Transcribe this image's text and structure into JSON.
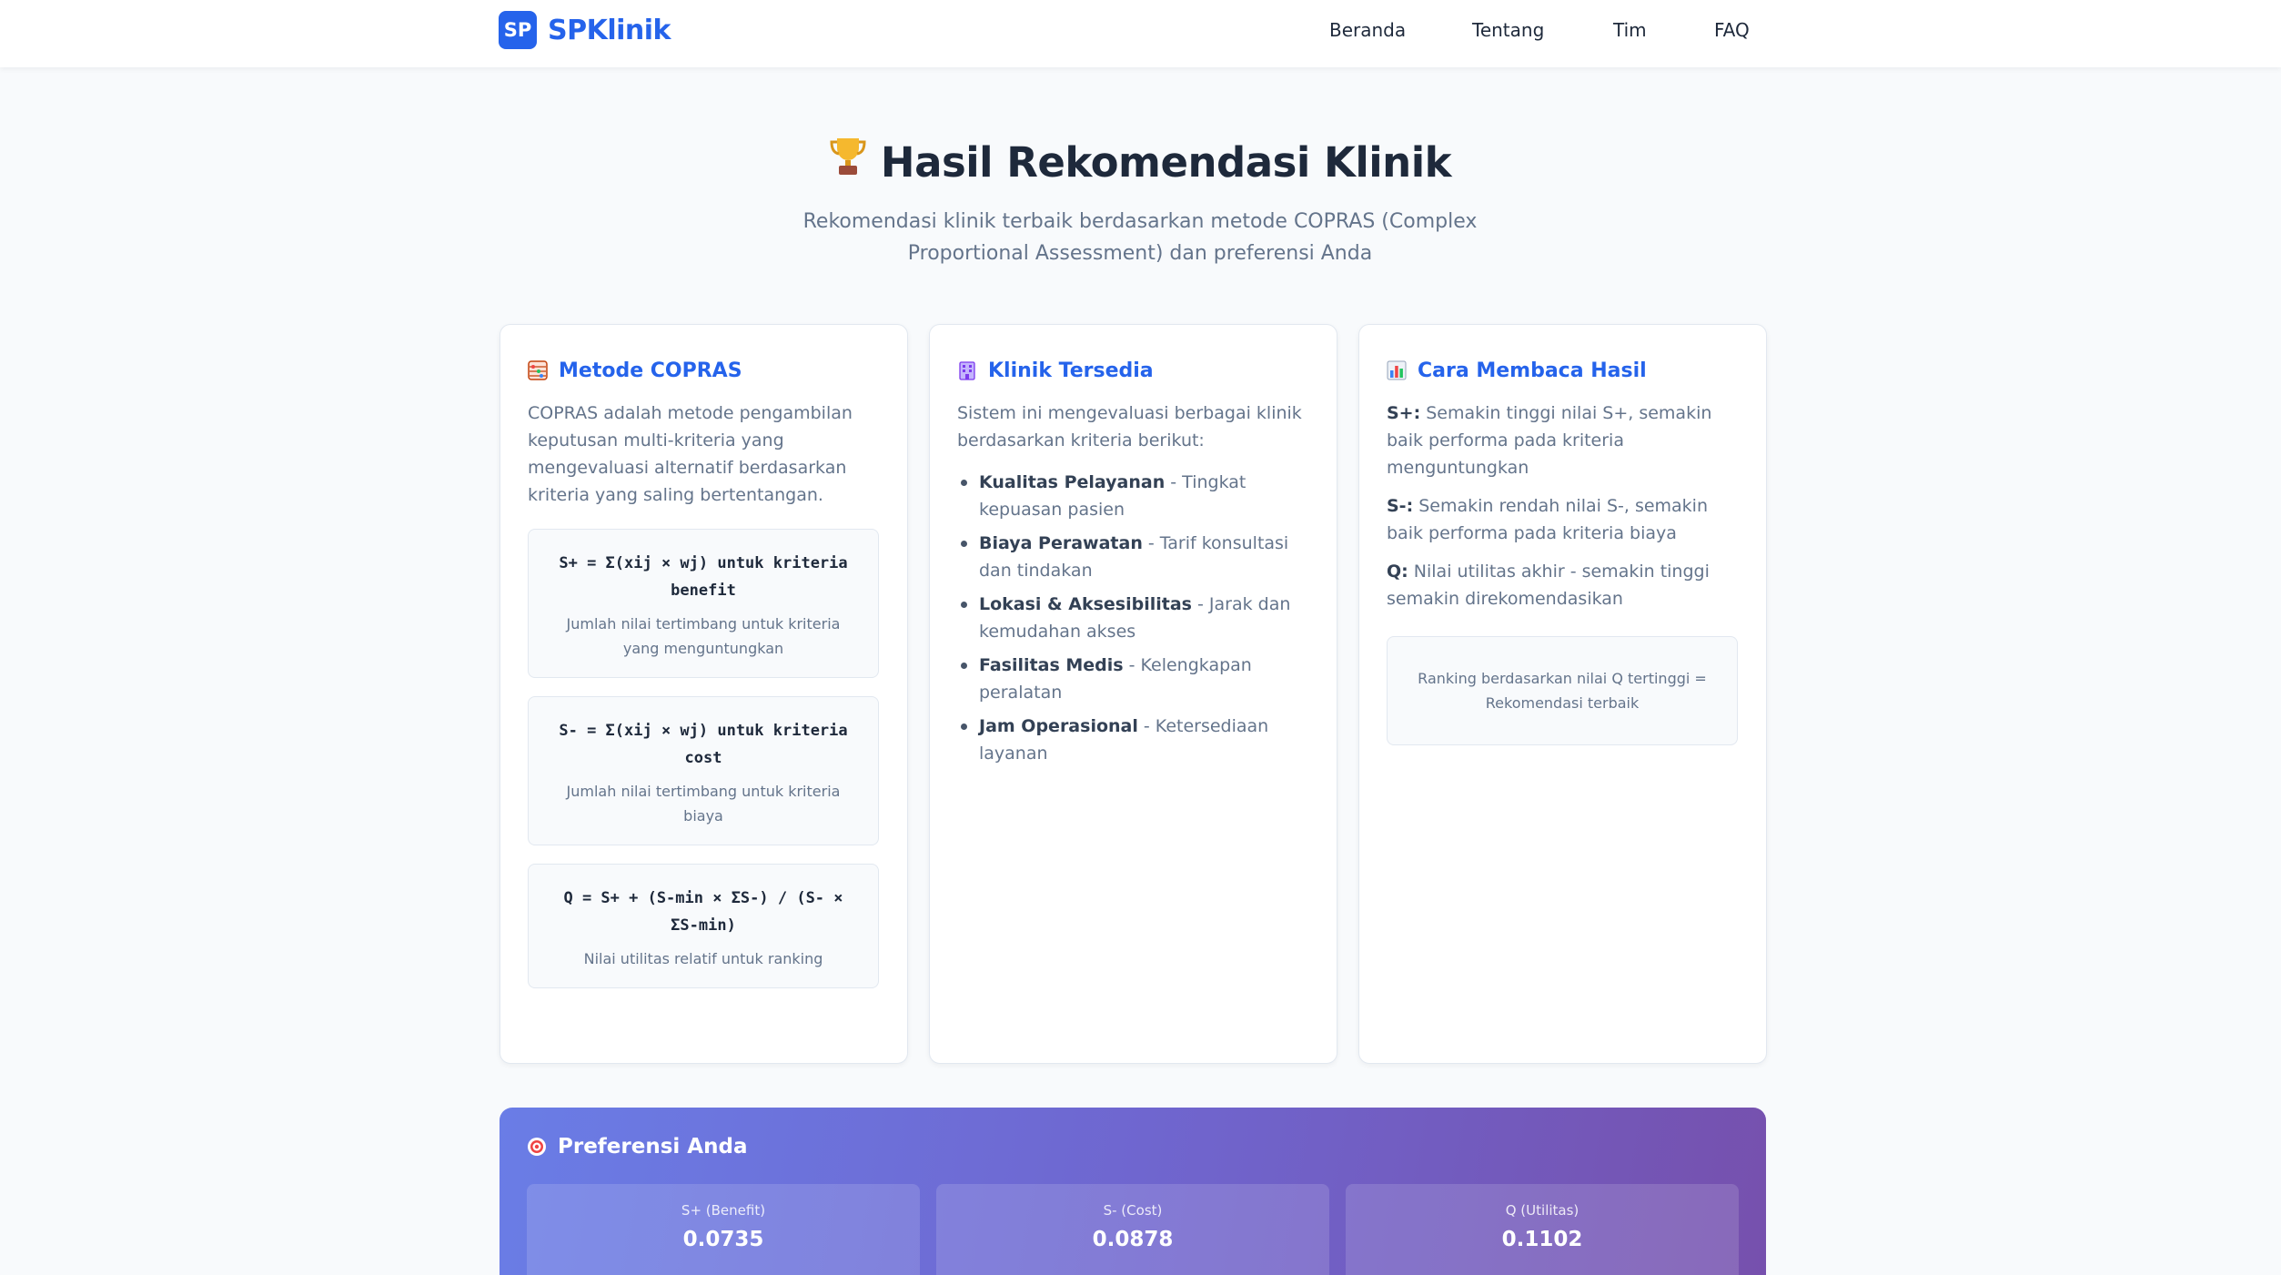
{
  "brand": {
    "badge": "SP",
    "name": "SPKlinik"
  },
  "nav": {
    "items": [
      "Beranda",
      "Tentang",
      "Tim",
      "FAQ"
    ]
  },
  "hero": {
    "title": "Hasil Rekomendasi Klinik",
    "subtitle": "Rekomendasi klinik terbaik berdasarkan metode COPRAS (Complex Proportional Assessment) dan preferensi Anda"
  },
  "cards": {
    "copras": {
      "title": "Metode COPRAS",
      "text": "COPRAS adalah metode pengambilan keputusan multi-kriteria yang mengevaluasi alternatif berdasarkan kriteria yang saling bertentangan.",
      "formulas": [
        {
          "formula": "S+ = Σ(xij × wj) untuk kriteria benefit",
          "desc": "Jumlah nilai tertimbang untuk kriteria yang menguntungkan"
        },
        {
          "formula": "S- = Σ(xij × wj) untuk kriteria cost",
          "desc": "Jumlah nilai tertimbang untuk kriteria biaya"
        },
        {
          "formula": "Q = S+ + (S-min × ΣS-) / (S- × ΣS-min)",
          "desc": "Nilai utilitas relatif untuk ranking"
        }
      ]
    },
    "klinik": {
      "title": "Klinik Tersedia",
      "text": "Sistem ini mengevaluasi berbagai klinik berdasarkan kriteria berikut:",
      "criteria": [
        {
          "name": "Kualitas Pelayanan",
          "desc": " - Tingkat kepuasan pasien"
        },
        {
          "name": "Biaya Perawatan",
          "desc": " - Tarif konsultasi dan tindakan"
        },
        {
          "name": "Lokasi & Aksesibilitas",
          "desc": " - Jarak dan kemudahan akses"
        },
        {
          "name": "Fasilitas Medis",
          "desc": " - Kelengkapan peralatan"
        },
        {
          "name": "Jam Operasional",
          "desc": " - Ketersediaan layanan"
        }
      ]
    },
    "baca": {
      "title": "Cara Membaca Hasil",
      "items": [
        {
          "key": "S+:",
          "text": " Semakin tinggi nilai S+, semakin baik performa pada kriteria menguntungkan"
        },
        {
          "key": "S-:",
          "text": " Semakin rendah nilai S-, semakin baik performa pada kriteria biaya"
        },
        {
          "key": "Q:",
          "text": " Nilai utilitas akhir - semakin tinggi semakin direkomendasikan"
        }
      ],
      "note": "Ranking berdasarkan nilai Q tertinggi = Rekomendasi terbaik"
    }
  },
  "preferensi": {
    "title": "Preferensi Anda",
    "stats": [
      {
        "label": "S+ (Benefit)",
        "value": "0.0735"
      },
      {
        "label": "S- (Cost)",
        "value": "0.0878"
      },
      {
        "label": "Q (Utilitas)",
        "value": "0.1102"
      }
    ]
  },
  "colors": {
    "accent": "#2563eb",
    "text": "#1e293b",
    "muted": "#64748b",
    "gradient_start": "#6a7de6",
    "gradient_end": "#7650ad"
  },
  "icons": {
    "hero": "trophy-icon",
    "copras": "abacus-icon",
    "klinik": "clinic-building-icon",
    "baca": "bar-chart-icon",
    "preferensi": "target-icon"
  }
}
